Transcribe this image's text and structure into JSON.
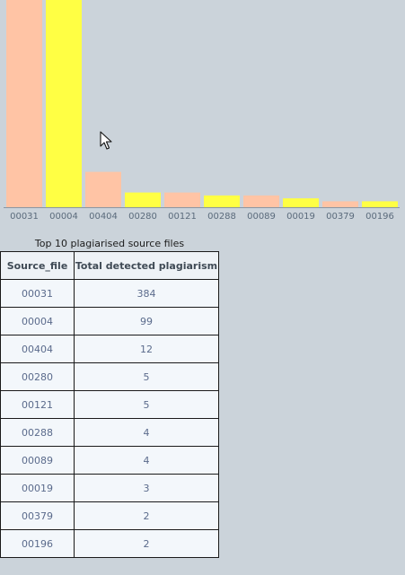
{
  "chart_data": {
    "type": "bar",
    "categories": [
      "00031",
      "00004",
      "00404",
      "00280",
      "00121",
      "00288",
      "00089",
      "00019",
      "00379",
      "00196"
    ],
    "values": [
      384,
      99,
      12,
      5,
      5,
      4,
      4,
      3,
      2,
      2
    ],
    "colors": [
      "#ffc4a5",
      "#ffff44",
      "#ffc4a5",
      "#ffff44",
      "#ffc4a5",
      "#ffff44",
      "#ffc4a5",
      "#ffff44",
      "#ffc4a5",
      "#ffff44"
    ],
    "ylim": [
      0,
      384
    ],
    "grid": false
  },
  "table": {
    "caption": "Top 10 plagiarised source files",
    "headers": [
      "Source_file",
      "Total detected plagiarism"
    ],
    "rows": [
      [
        "00031",
        "384"
      ],
      [
        "00004",
        "99"
      ],
      [
        "00404",
        "12"
      ],
      [
        "00280",
        "5"
      ],
      [
        "00121",
        "5"
      ],
      [
        "00288",
        "4"
      ],
      [
        "00089",
        "4"
      ],
      [
        "00019",
        "3"
      ],
      [
        "00379",
        "2"
      ],
      [
        "00196",
        "2"
      ]
    ]
  },
  "colors": {
    "background": "#cbd3da",
    "table_background": "#f3f7fb",
    "axis": "#8a96a3"
  },
  "icons": {
    "cursor": "mouse-pointer-icon"
  }
}
